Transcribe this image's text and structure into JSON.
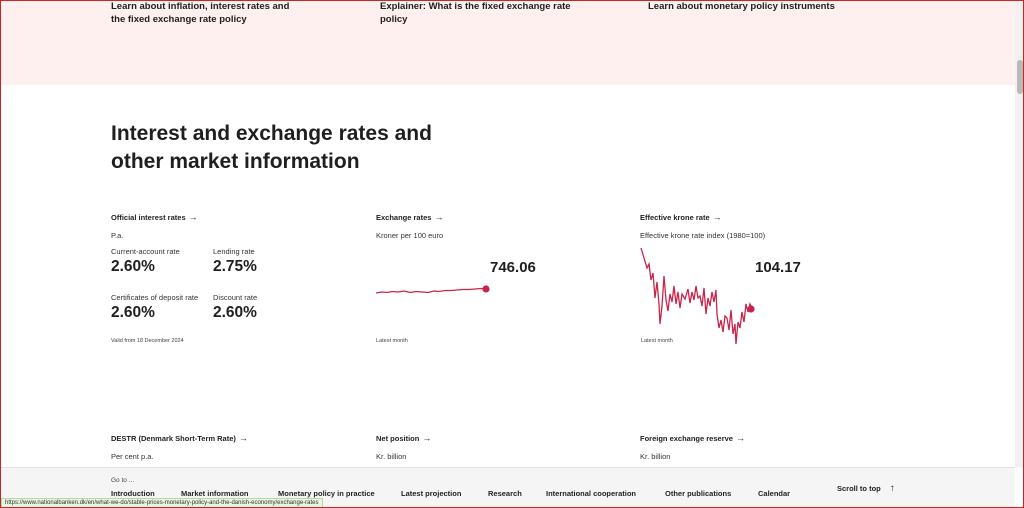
{
  "top_links": [
    {
      "line1": "Learn about inflation, interest rates and",
      "line2": "the fixed exchange rate policy"
    },
    {
      "line1": "Explainer: What is the fixed exchange rate",
      "line2": "policy"
    },
    {
      "line1": "Learn about monetary policy instruments",
      "line2": ""
    }
  ],
  "section": {
    "title_line1": "Interest and exchange rates and",
    "title_line2": "other market information"
  },
  "official_rates": {
    "heading": "Official interest rates",
    "unit": "P.a.",
    "items": [
      {
        "label": "Current-account rate",
        "value": "2.60%"
      },
      {
        "label": "Lending rate",
        "value": "2.75%"
      },
      {
        "label": "Certificates of deposit rate",
        "value": "2.60%"
      },
      {
        "label": "Discount rate",
        "value": "2.60%"
      }
    ],
    "valid_from": "Valid from 18 December 2024"
  },
  "exchange_rates": {
    "heading": "Exchange rates",
    "unit": "Kroner per 100 euro",
    "value": "746.06",
    "axis_note": "Latest month",
    "line_color": "#c8254a"
  },
  "effective_krone": {
    "heading": "Effective krone rate",
    "unit": "Effective krone rate index (1980=100)",
    "value": "104.17",
    "axis_note": "Latest month",
    "line_color": "#c8254a"
  },
  "lower_panels": [
    {
      "heading": "DESTR (Denmark Short-Term Rate)",
      "unit": "Per cent p.a."
    },
    {
      "heading": "Net position",
      "unit": "Kr. billion"
    },
    {
      "heading": "Foreign exchange reserve",
      "unit": "Kr. billion"
    }
  ],
  "arrow_glyph": "→",
  "bottom_nav": {
    "goto": "Go to ...",
    "items": [
      "Introduction",
      "Market information",
      "Monetary policy in practice",
      "Latest projection",
      "Research",
      "International cooperation",
      "Other publications",
      "Calendar"
    ],
    "scroll_top": "Scroll to top",
    "up_glyph": "↑"
  },
  "status_url": "https://www.nationalbanken.dk/en/what-we-do/stable-prices-monetary-policy-and-the-danish-economy/exchange-rates"
}
